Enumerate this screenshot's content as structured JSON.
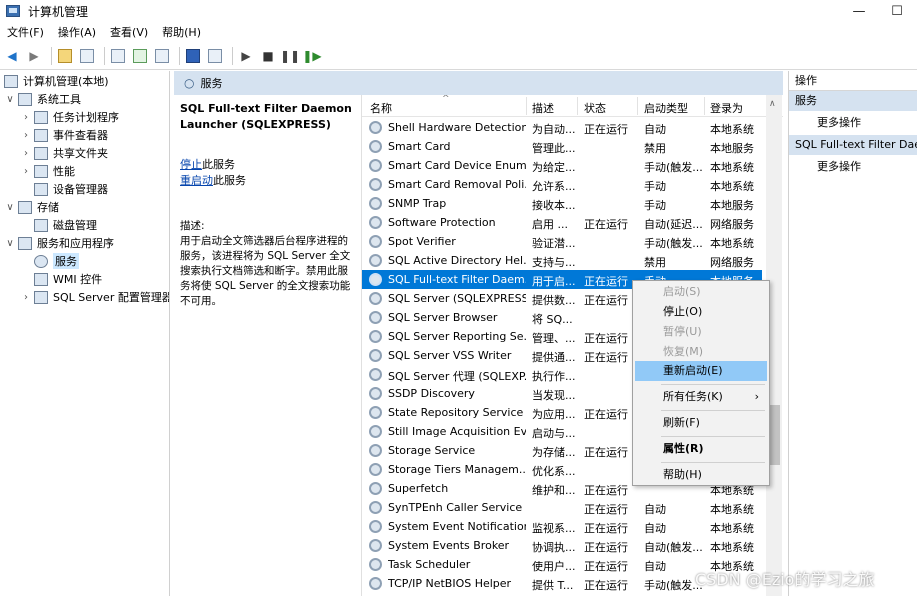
{
  "window": {
    "title": "计算机管理",
    "minimize": "—",
    "maximize": "☐"
  },
  "menubar": [
    "文件(F)",
    "操作(A)",
    "查看(V)",
    "帮助(H)"
  ],
  "tree": [
    {
      "label": "计算机管理(本地)",
      "arrow": "",
      "depth": 0
    },
    {
      "label": "系统工具",
      "arrow": "∨",
      "depth": 1
    },
    {
      "label": "任务计划程序",
      "arrow": "›",
      "depth": 2
    },
    {
      "label": "事件查看器",
      "arrow": "›",
      "depth": 2
    },
    {
      "label": "共享文件夹",
      "arrow": "›",
      "depth": 2
    },
    {
      "label": "性能",
      "arrow": "›",
      "depth": 2
    },
    {
      "label": "设备管理器",
      "arrow": "",
      "depth": 2
    },
    {
      "label": "存储",
      "arrow": "∨",
      "depth": 1
    },
    {
      "label": "磁盘管理",
      "arrow": "",
      "depth": 2
    },
    {
      "label": "服务和应用程序",
      "arrow": "∨",
      "depth": 1
    },
    {
      "label": "服务",
      "arrow": "",
      "depth": 2,
      "selected": true
    },
    {
      "label": "WMI 控件",
      "arrow": "",
      "depth": 2
    },
    {
      "label": "SQL Server 配置管理器",
      "arrow": "›",
      "depth": 2
    }
  ],
  "middle": {
    "header": "服务",
    "detail_title": "SQL Full-text Filter Daemon Launcher (SQLEXPRESS)",
    "stop_link": "停止",
    "stop_suffix": "此服务",
    "restart_link": "重启动",
    "restart_suffix": "此服务",
    "desc_label": "描述:",
    "desc_text": "用于启动全文筛选器后台程序进程的服务，该进程将为 SQL Server 全文搜索执行文档筛选和断字。禁用此服务将使 SQL Server 的全文搜索功能不可用。"
  },
  "columns": [
    "名称",
    "描述",
    "状态",
    "启动类型",
    "登录为"
  ],
  "services": [
    [
      "Shell Hardware Detection",
      "为自动...",
      "正在运行",
      "自动",
      "本地系统"
    ],
    [
      "Smart Card",
      "管理此...",
      "",
      "禁用",
      "本地服务"
    ],
    [
      "Smart Card Device Enum...",
      "为给定...",
      "",
      "手动(触发...",
      "本地系统"
    ],
    [
      "Smart Card Removal Poli...",
      "允许系...",
      "",
      "手动",
      "本地系统"
    ],
    [
      "SNMP Trap",
      "接收本...",
      "",
      "手动",
      "本地服务"
    ],
    [
      "Software Protection",
      "启用 ...",
      "正在运行",
      "自动(延迟...",
      "网络服务"
    ],
    [
      "Spot Verifier",
      "验证潜...",
      "",
      "手动(触发...",
      "本地系统"
    ],
    [
      "SQL Active Directory Hel...",
      "支持与...",
      "",
      "禁用",
      "网络服务"
    ],
    [
      "SQL Full-text Filter Daem...",
      "用于启...",
      "正在运行",
      "手动",
      "本地服务"
    ],
    [
      "SQL Server (SQLEXPRESS)",
      "提供数...",
      "正在运行",
      "",
      ""
    ],
    [
      "SQL Server Browser",
      "将 SQ...",
      "",
      "",
      ""
    ],
    [
      "SQL Server Reporting Se...",
      "管理、...",
      "正在运行",
      "",
      ""
    ],
    [
      "SQL Server VSS Writer",
      "提供通...",
      "正在运行",
      "",
      ""
    ],
    [
      "SQL Server 代理 (SQLEXP...",
      "执行作...",
      "",
      "",
      ""
    ],
    [
      "SSDP Discovery",
      "当发现...",
      "",
      "",
      ""
    ],
    [
      "State Repository Service",
      "为应用...",
      "正在运行",
      "",
      ""
    ],
    [
      "Still Image Acquisition Ev...",
      "启动与...",
      "",
      "",
      ""
    ],
    [
      "Storage Service",
      "为存储...",
      "正在运行",
      "",
      ""
    ],
    [
      "Storage Tiers Managem...",
      "优化系...",
      "",
      "",
      ""
    ],
    [
      "Superfetch",
      "维护和...",
      "正在运行",
      "",
      "本地系统"
    ],
    [
      "SynTPEnh Caller Service",
      "",
      "正在运行",
      "自动",
      "本地系统"
    ],
    [
      "System Event Notification...",
      "监视系...",
      "正在运行",
      "自动",
      "本地系统"
    ],
    [
      "System Events Broker",
      "协调执...",
      "正在运行",
      "自动(触发...",
      "本地系统"
    ],
    [
      "Task Scheduler",
      "使用户...",
      "正在运行",
      "自动",
      "本地系统"
    ],
    [
      "TCP/IP NetBIOS Helper",
      "提供 T...",
      "正在运行",
      "手动(触发...",
      ""
    ]
  ],
  "actions": {
    "header": "操作",
    "section1": "服务",
    "section1_item": "更多操作",
    "section2": "SQL Full-text Filter Daem",
    "section2_item": "更多操作"
  },
  "context_menu": {
    "start": "启动(S)",
    "stop": "停止(O)",
    "pause": "暂停(U)",
    "resume": "恢复(M)",
    "restart": "重新启动(E)",
    "all_tasks": "所有任务(K)",
    "refresh": "刷新(F)",
    "properties": "属性(R)",
    "help": "帮助(H)"
  },
  "watermark": "CSDN @Ezio的学习之旅",
  "colors": {
    "selection": "#0078d7",
    "pane_header": "#d5e2f0",
    "menu_highlight": "#91c9f7"
  }
}
